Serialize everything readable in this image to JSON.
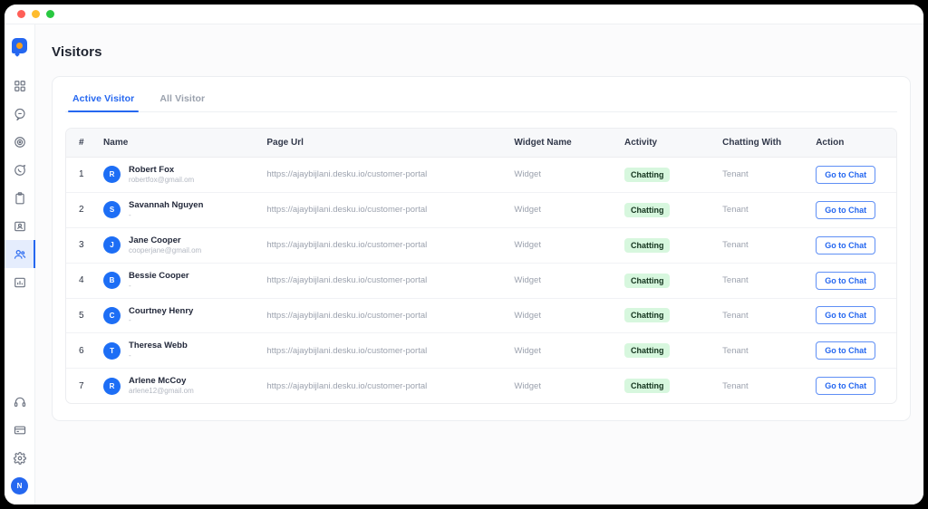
{
  "window": {
    "traffic_lights": [
      "close",
      "minimize",
      "maximize"
    ]
  },
  "sidebar": {
    "logo": "desku-logo",
    "items": [
      {
        "icon": "grid-dashboard-icon",
        "name": "dashboard",
        "active": false
      },
      {
        "icon": "chat-bubble-icon",
        "name": "conversations",
        "active": false
      },
      {
        "icon": "target-spiral-icon",
        "name": "campaigns",
        "active": false
      },
      {
        "icon": "whatsapp-icon",
        "name": "whatsapp",
        "active": false
      },
      {
        "icon": "clipboard-icon",
        "name": "tasks",
        "active": false
      },
      {
        "icon": "contact-card-icon",
        "name": "contacts",
        "active": false
      },
      {
        "icon": "users-icon",
        "name": "visitors",
        "active": true
      },
      {
        "icon": "bar-chart-icon",
        "name": "reports",
        "active": false
      }
    ],
    "bottom_items": [
      {
        "icon": "headset-icon",
        "name": "support"
      },
      {
        "icon": "credit-card-icon",
        "name": "billing"
      },
      {
        "icon": "gear-icon",
        "name": "settings"
      }
    ],
    "user_avatar": "N"
  },
  "page": {
    "title": "Visitors"
  },
  "tabs": [
    {
      "label": "Active Visitor",
      "active": true
    },
    {
      "label": "All Visitor",
      "active": false
    }
  ],
  "table": {
    "headers": [
      "#",
      "Name",
      "Page Url",
      "Widget Name",
      "Activity",
      "Chatting With",
      "Action"
    ],
    "rows": [
      {
        "index": "1",
        "initial": "R",
        "name": "Robert Fox",
        "email": "robertfox@gmail.om",
        "url": "https://ajaybijlani.desku.io/customer-portal",
        "widget": "Widget",
        "activity": "Chatting",
        "chatting_with": "Tenant",
        "action": "Go to Chat"
      },
      {
        "index": "2",
        "initial": "S",
        "name": "Savannah Nguyen",
        "email": "-",
        "url": "https://ajaybijlani.desku.io/customer-portal",
        "widget": "Widget",
        "activity": "Chatting",
        "chatting_with": "Tenant",
        "action": "Go to Chat"
      },
      {
        "index": "3",
        "initial": "J",
        "name": "Jane Cooper",
        "email": "cooperjane@gmail.om",
        "url": "https://ajaybijlani.desku.io/customer-portal",
        "widget": "Widget",
        "activity": "Chatting",
        "chatting_with": "Tenant",
        "action": "Go to Chat"
      },
      {
        "index": "4",
        "initial": "B",
        "name": "Bessie Cooper",
        "email": "-",
        "url": "https://ajaybijlani.desku.io/customer-portal",
        "widget": "Widget",
        "activity": "Chatting",
        "chatting_with": "Tenant",
        "action": "Go to Chat"
      },
      {
        "index": "5",
        "initial": "C",
        "name": "Courtney Henry",
        "email": "-",
        "url": "https://ajaybijlani.desku.io/customer-portal",
        "widget": "Widget",
        "activity": "Chatting",
        "chatting_with": "Tenant",
        "action": "Go to Chat"
      },
      {
        "index": "6",
        "initial": "T",
        "name": "Theresa Webb",
        "email": "-",
        "url": "https://ajaybijlani.desku.io/customer-portal",
        "widget": "Widget",
        "activity": "Chatting",
        "chatting_with": "Tenant",
        "action": "Go to Chat"
      },
      {
        "index": "7",
        "initial": "R",
        "name": "Arlene McCoy",
        "email": "arlene12@gmail.om",
        "url": "https://ajaybijlani.desku.io/customer-portal",
        "widget": "Widget",
        "activity": "Chatting",
        "chatting_with": "Tenant",
        "action": "Go to Chat"
      }
    ]
  },
  "colors": {
    "accent": "#2567f0",
    "avatar": "#1d6ef5",
    "badge_bg": "#d7f7de",
    "badge_text": "#12321c",
    "page_bg": "#fbfbfc",
    "card_bg": "#ffffff"
  }
}
